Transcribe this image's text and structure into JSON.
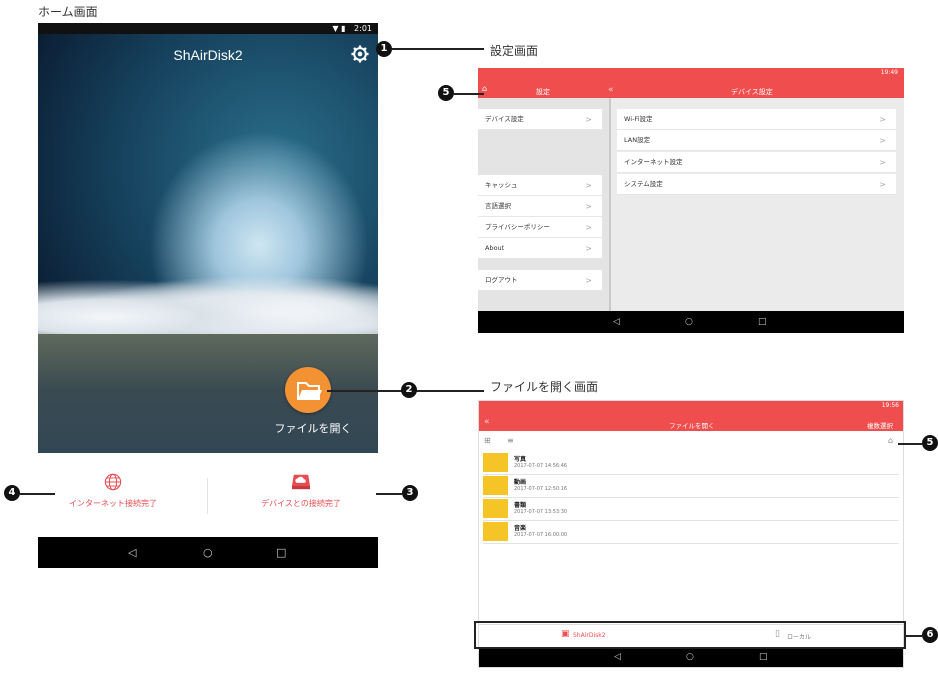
{
  "captions": {
    "home": "ホーム画面",
    "settings": "設定画面",
    "open_files": "ファイルを開く画面"
  },
  "phone": {
    "status_time": "2:01",
    "app_title": "ShAirDisk2",
    "open_files_label": "ファイルを開く",
    "internet_status": "インターネット接続完了",
    "device_status": "デバイスとの接続完了"
  },
  "settings_screen": {
    "status_time": "19:49",
    "left_title": "設定",
    "right_title": "デバイス設定",
    "left_groups": [
      [
        "デバイス設定"
      ],
      [
        "キャッシュ",
        "言語選択",
        "プライバシーポリシー",
        "About"
      ],
      [
        "ログアウト"
      ]
    ],
    "right_items": [
      "Wi-Fi設定",
      "LAN設定",
      "インターネット設定",
      "システム設定"
    ]
  },
  "files_screen": {
    "status_time": "19:56",
    "title": "ファイルを開く",
    "multi_select": "複数選択",
    "folders": [
      {
        "name": "写真",
        "date": "2017-07-07 14:56:46"
      },
      {
        "name": "動画",
        "date": "2017-07-07 12:50:16"
      },
      {
        "name": "書類",
        "date": "2017-07-07 13:53:30"
      },
      {
        "name": "音楽",
        "date": "2017-07-07 16:00:00"
      }
    ],
    "tab_shairdisk": "ShAirDisk2",
    "tab_local": "ローカル"
  },
  "callouts": [
    "1",
    "2",
    "3",
    "4",
    "5",
    "5",
    "6"
  ],
  "colors": {
    "accent_red": "#f04e4e",
    "orange": "#f29233",
    "folder": "#f5c527"
  }
}
